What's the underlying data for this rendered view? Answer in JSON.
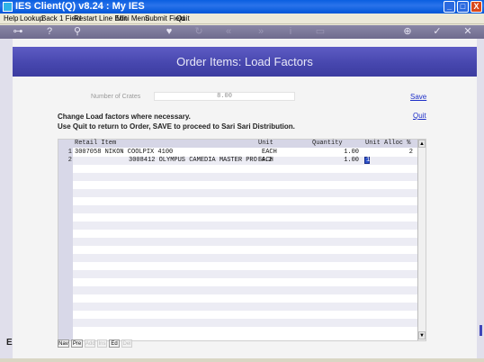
{
  "window": {
    "title": "IES Client(Q) v8.24 : My IES",
    "buttons": {
      "minimize": "_",
      "maximize": "□",
      "close": "X"
    }
  },
  "menu": {
    "items": [
      "Help",
      "Lookup",
      "Back 1 Field",
      "Restart Line Edit",
      "Mini Menu",
      "Submit Field",
      "Quit"
    ]
  },
  "toolbar": {
    "icons": [
      "key-icon",
      "help-icon",
      "search-icon",
      "heart-icon",
      "refresh-icon",
      "rewind-icon",
      "forward-icon",
      "info-icon",
      "document-icon",
      "globe-icon",
      "check-icon",
      "close-icon"
    ],
    "glyphs": {
      "key": "⊶",
      "help": "?",
      "search": "⚲",
      "heart": "♥",
      "refresh": "↻",
      "rewind": "«",
      "forward": "»",
      "info": "i",
      "doc": "▭",
      "globe": "⊕",
      "check": "✓",
      "close": "✕"
    }
  },
  "page": {
    "heading": "Order Items: Load Factors",
    "crates_label": "Number of Crates",
    "crates_value": "8.00",
    "save_link": "Save",
    "quit_link": "Quit",
    "instruction_1": "Change Load factors where necessary.",
    "instruction_2": "Use Quit to return to Order, SAVE to proceed to Sari Sari Distribution."
  },
  "grid": {
    "columns": [
      "Retail Item",
      "Unit",
      "Quantity",
      "Unit Alloc %"
    ],
    "rows": [
      {
        "num": "1",
        "item": "3007058 NIKON COOLPIX 4100",
        "unit": "EACH",
        "quantity": "1.00",
        "alloc": "2"
      },
      {
        "num": "2",
        "item": "3008412 OLYMPUS CAMEDIA MASTER PRO 4.2",
        "unit": "EACH",
        "quantity": "1.00",
        "alloc": "1"
      }
    ],
    "scroll_up": "▲",
    "scroll_down": "▼"
  },
  "nav": {
    "buttons": [
      {
        "label": "Nav",
        "enabled": true
      },
      {
        "label": "Pre",
        "enabled": true
      },
      {
        "label": "Add",
        "enabled": false
      },
      {
        "label": "Ins",
        "enabled": false
      },
      {
        "label": "Ed",
        "enabled": true
      },
      {
        "label": "Del",
        "enabled": false
      }
    ]
  },
  "left_marker": "E"
}
